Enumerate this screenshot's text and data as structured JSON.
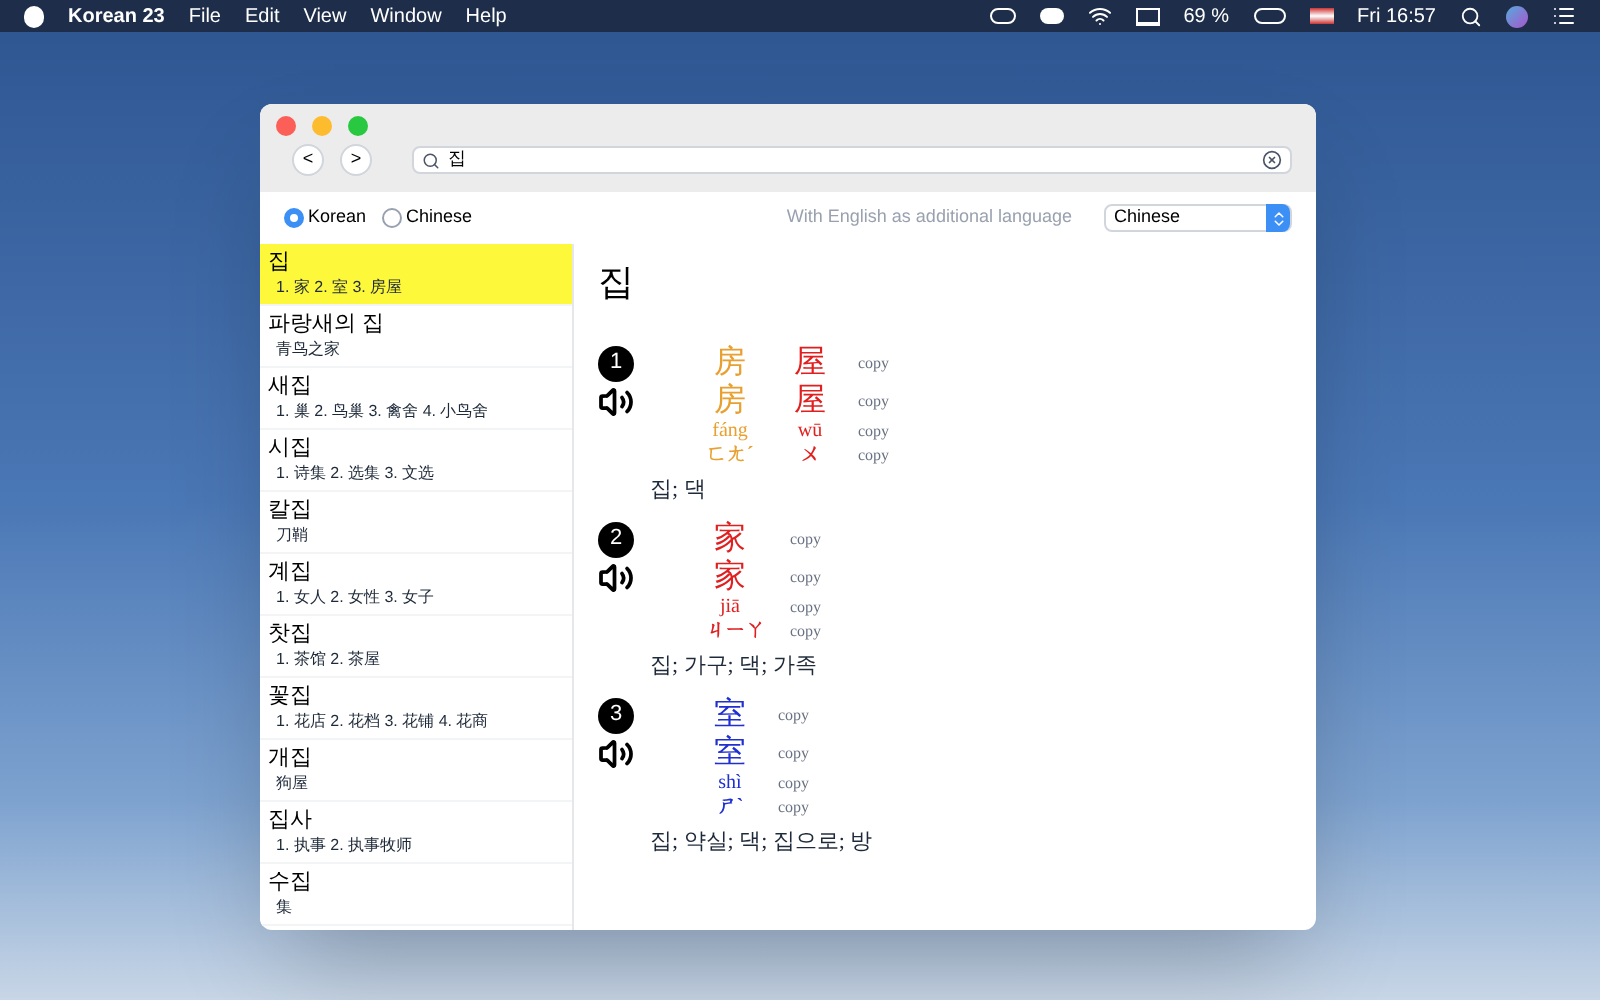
{
  "menubar": {
    "app": "Korean 23",
    "menus": [
      "File",
      "Edit",
      "View",
      "Window",
      "Help"
    ],
    "battery": "69 %",
    "clock": "Fri 16:57"
  },
  "toolbar": {
    "back": "<",
    "forward": ">",
    "search": {
      "value": "집"
    }
  },
  "options": {
    "languages": [
      {
        "label": "Korean",
        "selected": true
      },
      {
        "label": "Chinese",
        "selected": false
      }
    ],
    "additional_label": "With English as additional language",
    "dropdown": {
      "value": "Chinese"
    }
  },
  "results": [
    {
      "word": "집",
      "translations": "1. 家 2. 室 3. 房屋",
      "selected": true
    },
    {
      "word": "파랑새의 집",
      "translations": "青鸟之家",
      "selected": false
    },
    {
      "word": "새집",
      "translations": "1. 巢 2. 鸟巢 3. 禽舍 4. 小鸟舍",
      "selected": false
    },
    {
      "word": "시집",
      "translations": "1. 诗集 2. 选集 3. 文选",
      "selected": false
    },
    {
      "word": "칼집",
      "translations": "刀鞘",
      "selected": false
    },
    {
      "word": "계집",
      "translations": "1. 女人 2. 女性 3. 女子",
      "selected": false
    },
    {
      "word": "찻집",
      "translations": "1. 茶馆 2. 茶屋",
      "selected": false
    },
    {
      "word": "꽃집",
      "translations": "1. 花店 2. 花档 3. 花铺 4. 花商",
      "selected": false
    },
    {
      "word": "개집",
      "translations": "狗屋",
      "selected": false
    },
    {
      "word": "집사",
      "translations": "1. 执事 2. 执事牧师",
      "selected": false
    },
    {
      "word": "수집",
      "translations": "集",
      "selected": false
    }
  ],
  "entry": {
    "headword": "집",
    "senses": [
      {
        "number": "1",
        "rows": [
          {
            "kind": "simplified",
            "cells": [
              {
                "text": "房",
                "color": "#e8a030"
              },
              {
                "text": "屋",
                "color": "#e02020"
              }
            ],
            "action": "copy"
          },
          {
            "kind": "traditional",
            "cells": [
              {
                "text": "房",
                "color": "#e8a030"
              },
              {
                "text": "屋",
                "color": "#e02020"
              }
            ],
            "action": "copy"
          },
          {
            "kind": "pinyin",
            "cells": [
              {
                "text": "fáng",
                "color": "#e8a030"
              },
              {
                "text": "wū",
                "color": "#e02020"
              }
            ],
            "action": "copy"
          },
          {
            "kind": "zhuyin",
            "cells": [
              {
                "text": "ㄈㄤˊ",
                "color": "#e8a030"
              },
              {
                "text": "ㄨ",
                "color": "#e02020"
              }
            ],
            "action": "copy"
          }
        ],
        "meaning": "집; 댁"
      },
      {
        "number": "2",
        "rows": [
          {
            "kind": "simplified",
            "cells": [
              {
                "text": "家",
                "color": "#e02020"
              }
            ],
            "action": "copy"
          },
          {
            "kind": "traditional",
            "cells": [
              {
                "text": "家",
                "color": "#e02020"
              }
            ],
            "action": "copy"
          },
          {
            "kind": "pinyin",
            "cells": [
              {
                "text": "jiā",
                "color": "#e02020"
              }
            ],
            "action": "copy"
          },
          {
            "kind": "zhuyin",
            "cells": [
              {
                "text": "ㄐㄧㄚ",
                "color": "#e02020"
              }
            ],
            "action": "copy"
          }
        ],
        "meaning": "집; 가구; 댁; 가족"
      },
      {
        "number": "3",
        "rows": [
          {
            "kind": "simplified",
            "cells": [
              {
                "text": "室",
                "color": "#2030d0"
              }
            ],
            "action": "copy"
          },
          {
            "kind": "traditional",
            "cells": [
              {
                "text": "室",
                "color": "#2030d0"
              }
            ],
            "action": "copy"
          },
          {
            "kind": "pinyin",
            "cells": [
              {
                "text": "shì",
                "color": "#2030d0"
              }
            ],
            "action": "copy"
          },
          {
            "kind": "zhuyin",
            "cells": [
              {
                "text": "ㄕˋ",
                "color": "#2030d0"
              }
            ],
            "action": "copy"
          }
        ],
        "meaning": "집; 약실; 댁; 집으로; 방"
      }
    ]
  }
}
